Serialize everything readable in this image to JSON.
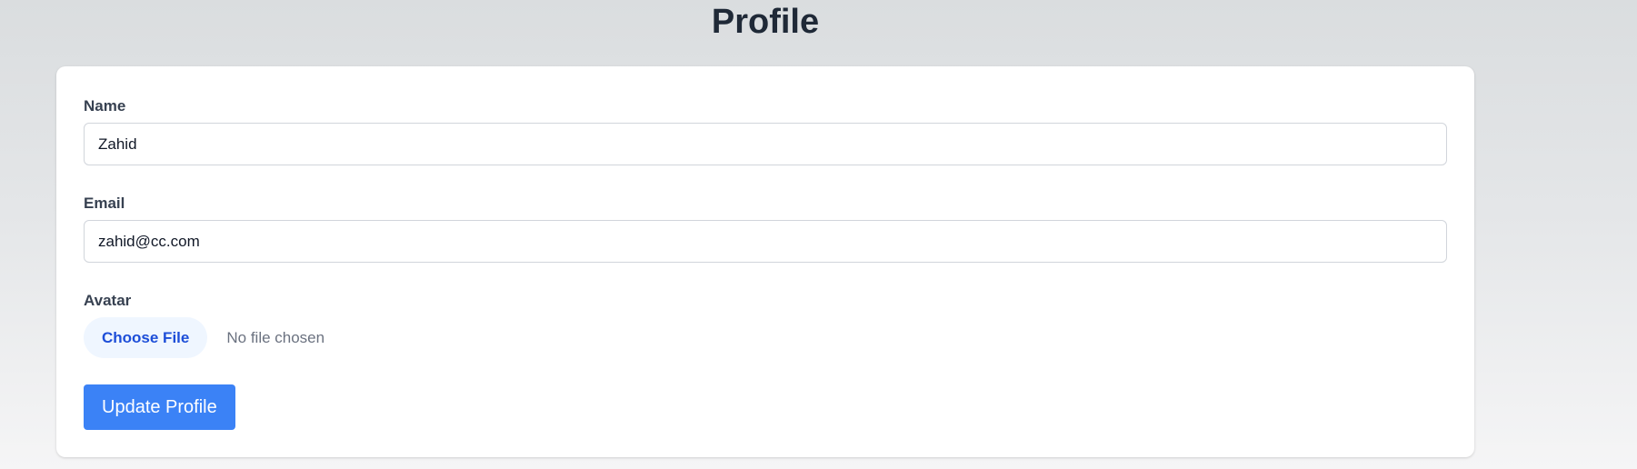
{
  "page": {
    "title": "Profile"
  },
  "form": {
    "name": {
      "label": "Name",
      "value": "Zahid"
    },
    "email": {
      "label": "Email",
      "value": "zahid@cc.com"
    },
    "avatar": {
      "label": "Avatar",
      "button_label": "Choose File",
      "status": "No file chosen"
    },
    "submit_label": "Update Profile"
  },
  "colors": {
    "primary_button": "#3b82f6",
    "file_button_bg": "#eff6ff",
    "file_button_text": "#1d4ed8",
    "heading_text": "#1f2937"
  }
}
